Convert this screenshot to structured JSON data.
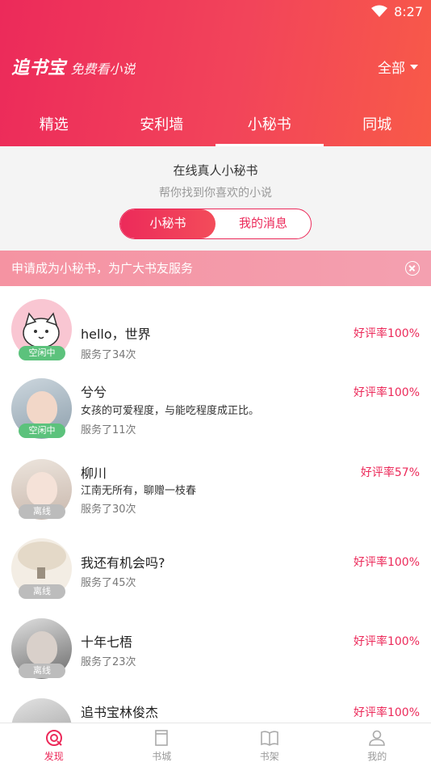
{
  "status_bar": {
    "time": "8:27"
  },
  "header": {
    "logo": "追书宝",
    "slogan": "免费看小说",
    "filter": "全部",
    "tabs": [
      {
        "label": "精选",
        "active": false
      },
      {
        "label": "安利墙",
        "active": false
      },
      {
        "label": "小秘书",
        "active": true
      },
      {
        "label": "同城",
        "active": false
      }
    ]
  },
  "intro": {
    "title": "在线真人小秘书",
    "subtitle": "帮你找到你喜欢的小说",
    "switch": {
      "left": "小秘书",
      "right": "我的消息"
    }
  },
  "banner": {
    "text": "申请成为小秘书，为广大书友服务"
  },
  "secretaries": [
    {
      "name": "hello，世界",
      "motto": "",
      "served": "服务了34次",
      "rating": "好评率100%",
      "status": "空闲中"
    },
    {
      "name": "兮兮",
      "motto": "女孩的可爱程度，与能吃程度成正比。",
      "served": "服务了11次",
      "rating": "好评率100%",
      "status": "空闲中"
    },
    {
      "name": "柳川",
      "motto": "江南无所有，聊赠一枝春",
      "served": "服务了30次",
      "rating": "好评率57%",
      "status": "离线"
    },
    {
      "name": "我还有机会吗?",
      "motto": "",
      "served": "服务了45次",
      "rating": "好评率100%",
      "status": "离线"
    },
    {
      "name": "十年七梧",
      "motto": "",
      "served": "服务了23次",
      "rating": "好评率100%",
      "status": "离线"
    },
    {
      "name": "追书宝林俊杰",
      "motto": "",
      "served": "",
      "rating": "好评率100%",
      "status": ""
    }
  ],
  "bottom_nav": [
    {
      "label": "发现",
      "icon": "discover-icon",
      "active": true
    },
    {
      "label": "书城",
      "icon": "bookstore-icon",
      "active": false
    },
    {
      "label": "书架",
      "icon": "bookshelf-icon",
      "active": false
    },
    {
      "label": "我的",
      "icon": "profile-icon",
      "active": false
    }
  ],
  "colors": {
    "accent": "#ec2a5a",
    "idle": "#5cc27c",
    "offline": "#bcbcbc"
  }
}
